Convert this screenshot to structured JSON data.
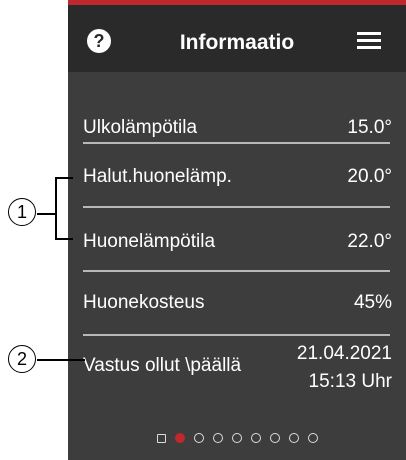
{
  "header": {
    "title": "Informaatio",
    "help_icon": "?",
    "menu_icon": "hamburger-menu-icon"
  },
  "rows": [
    {
      "label": "Ulkolämpötila",
      "value": "15.0°"
    },
    {
      "label": "Halut.huonelämp.",
      "value": "20.0°"
    },
    {
      "label": "Huonelämpötila",
      "value": "22.0°"
    },
    {
      "label": "Huonekosteus",
      "value": "45%"
    },
    {
      "label": "Vastus ollut \\päällä",
      "value_line1": "21.04.2021",
      "value_line2": "15:13 Uhr"
    }
  ],
  "callouts": [
    "1",
    "2"
  ],
  "pager": {
    "count": 9,
    "active_index": 1
  },
  "colors": {
    "accent": "#c0282d",
    "background": "#3d3d3d",
    "header": "#2a2a2a"
  }
}
